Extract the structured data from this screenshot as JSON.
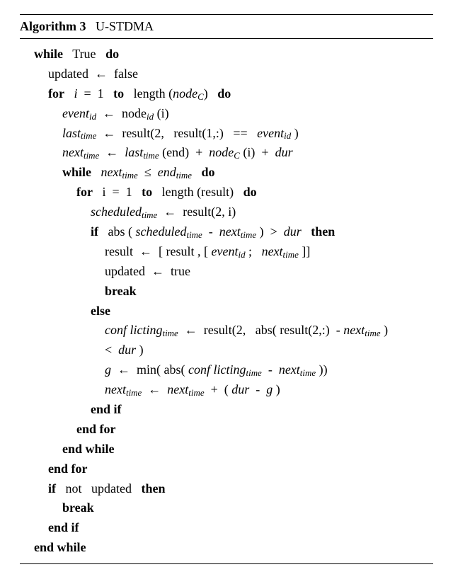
{
  "header": {
    "algolabel": "Algorithm 3",
    "title": "U-STDMA"
  },
  "kw": {
    "while": "while",
    "do": "do",
    "for": "for",
    "to": "to",
    "if": "if",
    "then": "then",
    "else": "else",
    "endif": "end if",
    "endfor": "end for",
    "endwhile": "end while",
    "break": "break",
    "not": "not"
  },
  "v": {
    "true_cap": "True",
    "updated": "updated",
    "false": "false",
    "true": "true",
    "i": "i",
    "one": "1",
    "length": "length",
    "nodeC": "node",
    "nodeC_sub": "C",
    "event": "event",
    "id": "id",
    "node": "node",
    "last": "last",
    "time": "time",
    "result": "result",
    "next": "next",
    "end_": "end",
    "dur": "dur",
    "scheduled": "scheduled",
    "abs": "abs",
    "conflicting": "conf licting",
    "g": "g",
    "min": "min",
    "gt": ">",
    "le": "≤",
    "lt": "<",
    "minus": "-",
    "plus": "+",
    "eqeq": "=="
  },
  "expr": {
    "node_id_i": "(i)",
    "row1_arg": "(1,:)",
    "row2_arg": "(2,",
    "close": ")",
    "two_i": "(2, i)",
    "two_colon": "(2,:)",
    "last_end": "(end)",
    "node_C_i": "(i)",
    "append_open": "[",
    "append_mid": ", [",
    "append_sep": ";",
    "append_close": "]]",
    "paren_open": "(",
    "paren_close": ")"
  }
}
